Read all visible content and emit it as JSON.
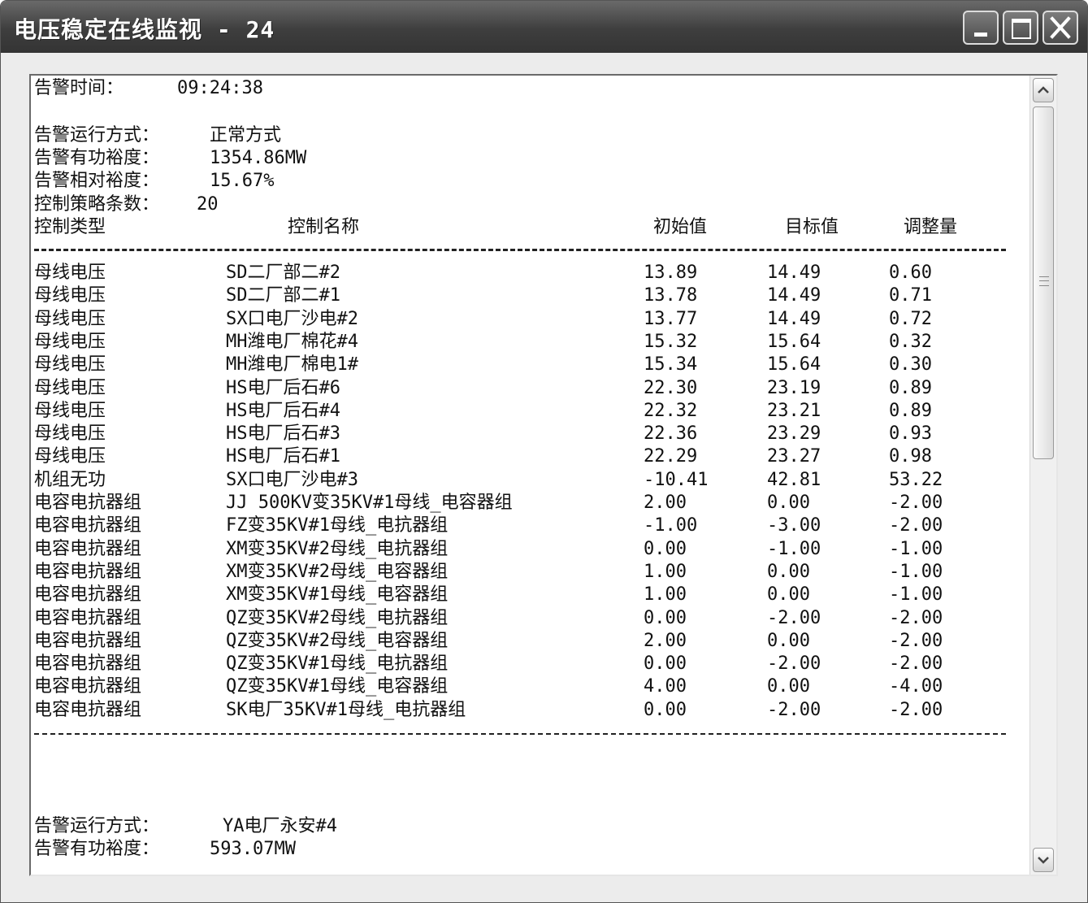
{
  "window": {
    "title": "电压稳定在线监视 - 24"
  },
  "alarm": {
    "time_label": "告警时间：",
    "time_value": "09:24:38",
    "mode_label": "告警运行方式：",
    "mode_value": "正常方式",
    "active_margin_label": "告警有功裕度：",
    "active_margin_value": "1354.86MW",
    "relative_margin_label": "告警相对裕度：",
    "relative_margin_value": "15.67%",
    "strategy_count_label": "控制策略条数：",
    "strategy_count_value": "20"
  },
  "table": {
    "headers": {
      "type": "控制类型",
      "name": "控制名称",
      "initial": "初始值",
      "target": "目标值",
      "adjust": "调整量"
    },
    "rows": [
      {
        "type": "母线电压",
        "name": "SD二厂部二#2",
        "initial": "13.89",
        "target": "14.49",
        "adjust": "0.60"
      },
      {
        "type": "母线电压",
        "name": "SD二厂部二#1",
        "initial": "13.78",
        "target": "14.49",
        "adjust": "0.71"
      },
      {
        "type": "母线电压",
        "name": "SX口电厂沙电#2",
        "initial": "13.77",
        "target": "14.49",
        "adjust": "0.72"
      },
      {
        "type": "母线电压",
        "name": "MH潍电厂棉花#4",
        "initial": "15.32",
        "target": "15.64",
        "adjust": "0.32"
      },
      {
        "type": "母线电压",
        "name": "MH潍电厂棉电1#",
        "initial": "15.34",
        "target": "15.64",
        "adjust": "0.30"
      },
      {
        "type": "母线电压",
        "name": "HS电厂后石#6",
        "initial": "22.30",
        "target": "23.19",
        "adjust": "0.89"
      },
      {
        "type": "母线电压",
        "name": "HS电厂后石#4",
        "initial": "22.32",
        "target": "23.21",
        "adjust": "0.89"
      },
      {
        "type": "母线电压",
        "name": "HS电厂后石#3",
        "initial": "22.36",
        "target": "23.29",
        "adjust": "0.93"
      },
      {
        "type": "母线电压",
        "name": "HS电厂后石#1",
        "initial": "22.29",
        "target": "23.27",
        "adjust": "0.98"
      },
      {
        "type": "机组无功",
        "name": "SX口电厂沙电#3",
        "initial": "-10.41",
        "target": "42.81",
        "adjust": "53.22"
      },
      {
        "type": "电容电抗器组",
        "name": "JJ 500KV变35KV#1母线_电容器组",
        "initial": "2.00",
        "target": "0.00",
        "adjust": "-2.00"
      },
      {
        "type": "电容电抗器组",
        "name": "FZ变35KV#1母线_电抗器组",
        "initial": "-1.00",
        "target": "-3.00",
        "adjust": "-2.00"
      },
      {
        "type": "电容电抗器组",
        "name": "XM变35KV#2母线_电抗器组",
        "initial": "0.00",
        "target": "-1.00",
        "adjust": "-1.00"
      },
      {
        "type": "电容电抗器组",
        "name": "XM变35KV#2母线_电容器组",
        "initial": "1.00",
        "target": "0.00",
        "adjust": "-1.00"
      },
      {
        "type": "电容电抗器组",
        "name": "XM变35KV#1母线_电容器组",
        "initial": "1.00",
        "target": "0.00",
        "adjust": "-1.00"
      },
      {
        "type": "电容电抗器组",
        "name": "QZ变35KV#2母线_电抗器组",
        "initial": "0.00",
        "target": "-2.00",
        "adjust": "-2.00"
      },
      {
        "type": "电容电抗器组",
        "name": "QZ变35KV#2母线_电容器组",
        "initial": "2.00",
        "target": "0.00",
        "adjust": "-2.00"
      },
      {
        "type": "电容电抗器组",
        "name": "QZ变35KV#1母线_电抗器组",
        "initial": "0.00",
        "target": "-2.00",
        "adjust": "-2.00"
      },
      {
        "type": "电容电抗器组",
        "name": "QZ变35KV#1母线_电容器组",
        "initial": "4.00",
        "target": "0.00",
        "adjust": "-4.00"
      },
      {
        "type": "电容电抗器组",
        "name": "SK电厂35KV#1母线_电抗器组",
        "initial": "0.00",
        "target": "-2.00",
        "adjust": "-2.00"
      }
    ]
  },
  "alarm2": {
    "mode_label": "告警运行方式：",
    "mode_value": "YA电厂永安#4",
    "active_margin_label": "告警有功裕度：",
    "active_margin_value": "593.07MW"
  },
  "icons": {
    "minimize": "minimize-icon",
    "maximize": "maximize-icon",
    "close": "close-icon",
    "scroll_up": "arrow-up-icon",
    "scroll_down": "arrow-down-icon"
  }
}
